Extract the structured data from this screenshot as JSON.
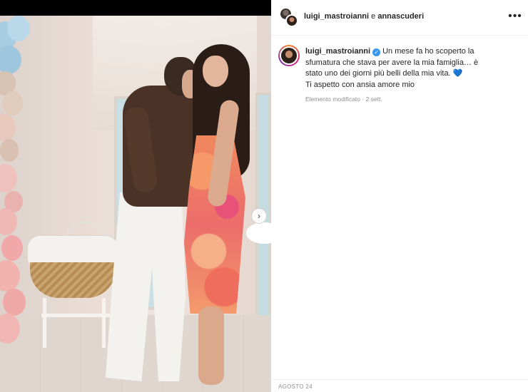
{
  "header": {
    "user_primary": "luigi_mastroianni",
    "connector": "e",
    "user_secondary": "annascuderi",
    "more_icon": "ellipsis-icon"
  },
  "caption": {
    "username": "luigi_mastroianni",
    "verified_icon": "verified-badge-icon",
    "text": "Un mese fa ho scoperto la sfumatura che stava per avere la mia famiglia… è stato uno dei giorni più belli della mia vita.",
    "emoji": "💙",
    "line2": "Ti aspetto con ansia amore mio",
    "meta": "Elemento modificato · 2 sett."
  },
  "footer": {
    "date": "AGOSTO 24"
  },
  "media": {
    "next_icon": "chevron-right-icon",
    "next_glyph": "›"
  }
}
